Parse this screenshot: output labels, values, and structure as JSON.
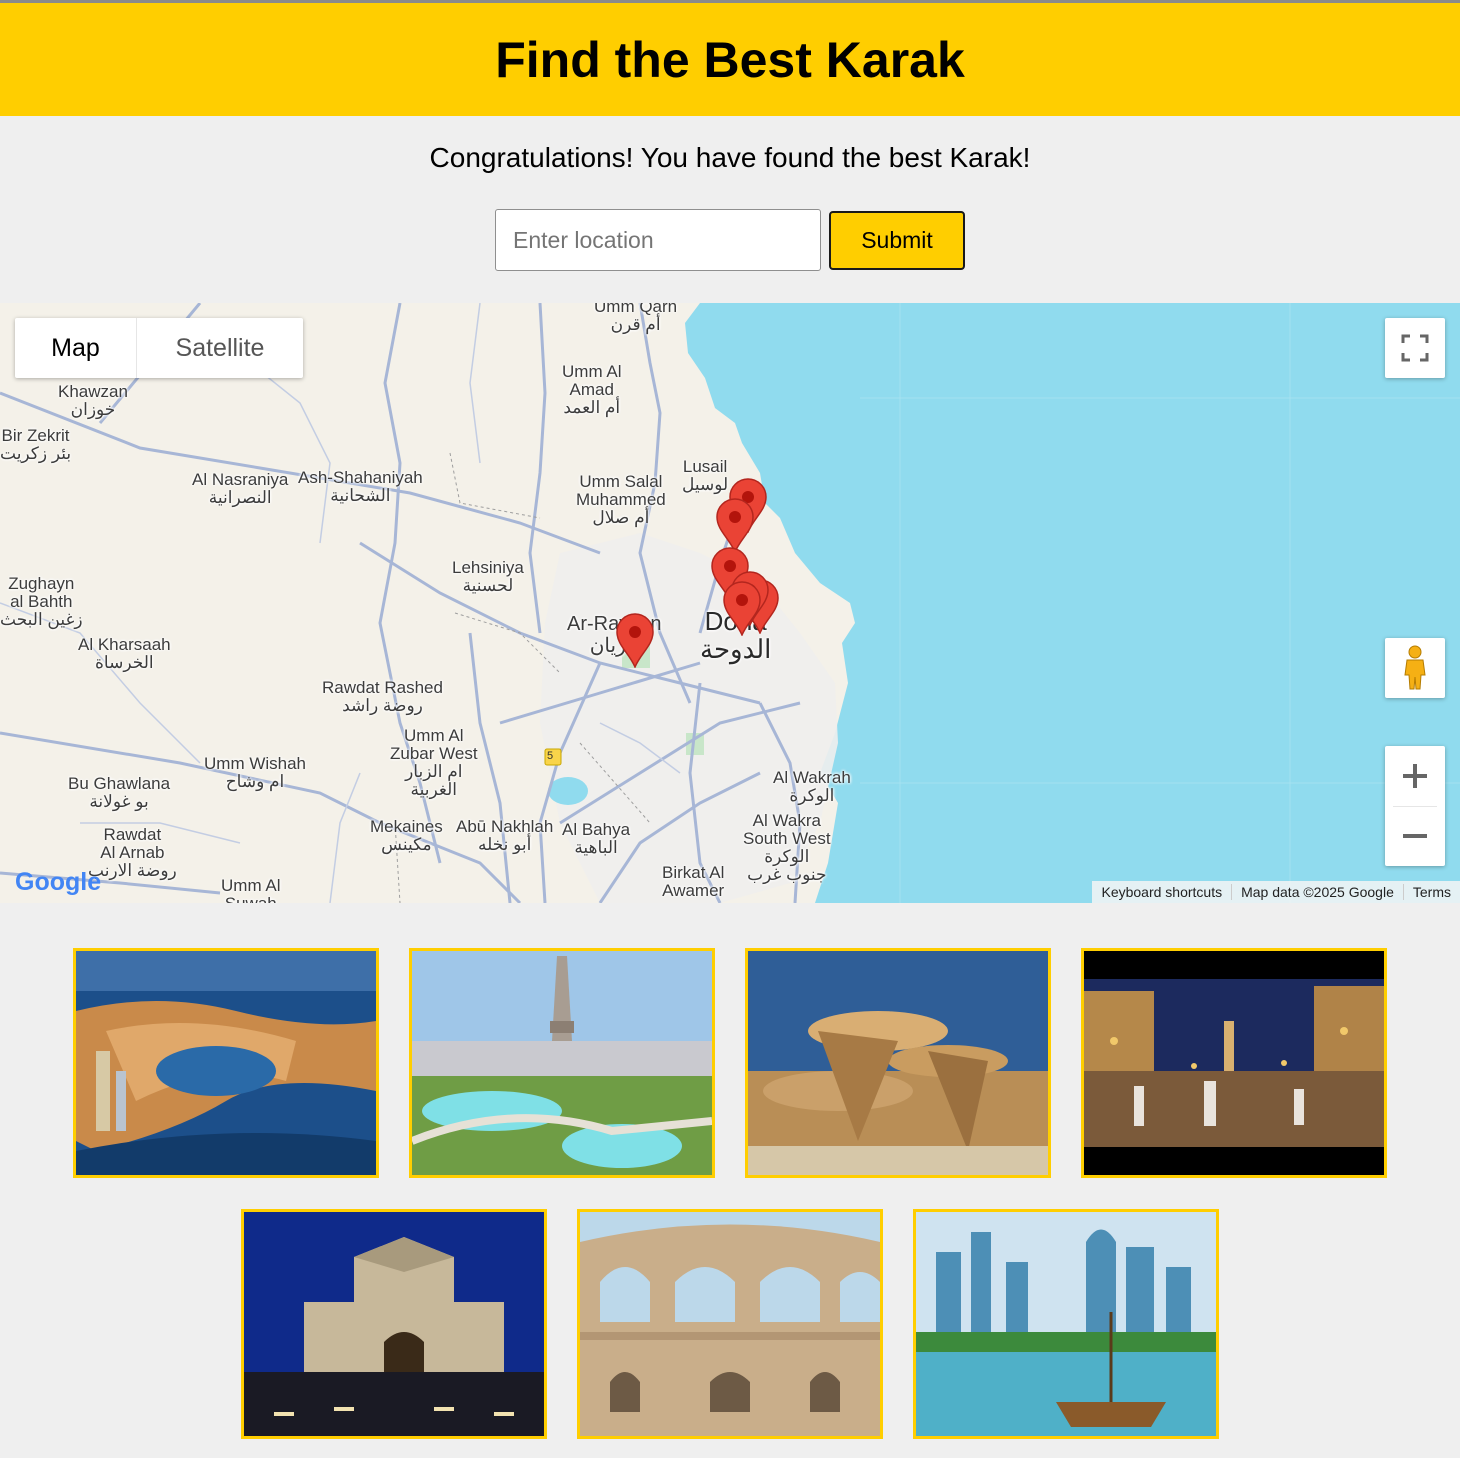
{
  "header": {
    "title": "Find the Best Karak"
  },
  "message": "Congratulations! You have found the best Karak!",
  "form": {
    "placeholder": "Enter location",
    "value": "",
    "submit_label": "Submit"
  },
  "map": {
    "type_map": "Map",
    "type_satellite": "Satellite",
    "labels": {
      "umm_qarn": "Umm Qarn",
      "umm_qarn_ar": "أم قرن",
      "umm_al_amad_1": "Umm Al",
      "umm_al_amad_2": "Amad",
      "umm_al_amad_ar": "أم العمد",
      "khawzan": "Khawzan",
      "khawzan_ar": "خوزان",
      "bir_zekrit": "Bir Zekrit",
      "bir_zekrit_ar": "بئر زكريت",
      "al_nasraniya": "Al Nasraniya",
      "al_nasraniya_ar": "النصرانية",
      "ash_shahaniyah": "Ash-Shahaniyah",
      "ash_shahaniyah_ar": "الشحانية",
      "lusail": "Lusail",
      "lusail_ar": "لوسيل",
      "umm_salal_1": "Umm Salal",
      "umm_salal_2": "Muhammed",
      "umm_salal_ar": "أم صلال",
      "lehsiniya": "Lehsiniya",
      "lehsiniya_ar": "لحسنية",
      "zughayn_1": "Zughayn",
      "zughayn_2": "al Bahth",
      "zughayn_ar": "زغين البحث",
      "al_kharsaah": "Al Kharsaah",
      "al_kharsaah_ar": "الخرساة",
      "ar_rayyan": "Ar-Rayyan",
      "ar_rayyan_ar": "الريان",
      "doha": "Doha",
      "doha_ar": "الدوحة",
      "rawdat_rashed": "Rawdat Rashed",
      "rawdat_rashed_ar": "روضة راشد",
      "umm_al_zubar_1": "Umm Al",
      "umm_al_zubar_2": "Zubar West",
      "umm_al_zubar_ar1": "ام الزبار",
      "umm_al_zubar_ar2": "الغربية",
      "umm_wishah": "Umm Wishah",
      "umm_wishah_ar": "ام وشاح",
      "bu_ghawlana": "Bu Ghawlana",
      "bu_ghawlana_ar": "بو غولانة",
      "rawdat_al_arnab_1": "Rawdat",
      "rawdat_al_arnab_2": "Al Arnab",
      "rawdat_al_arnab_ar": "روضة الارنب",
      "mekaines": "Mekaines",
      "mekaines_ar": "مكينس",
      "abu_nakhlah": "Abū Nakhlah",
      "abu_nakhlah_ar": "أبو نخله",
      "al_bahya": "Al Bahya",
      "al_bahya_ar": "الباهية",
      "al_wakrah": "Al Wakrah",
      "al_wakrah_ar": "الوكرة",
      "al_wakra_sw_1": "Al Wakra",
      "al_wakra_sw_2": "South West",
      "al_wakra_sw_ar1": "الوكرة",
      "al_wakra_sw_ar2": "جنوب غرب",
      "birkat_1": "Birkat Al",
      "birkat_2": "Awamer",
      "umm_al_suwah_1": "Umm Al",
      "umm_al_suwah_2": "Suwah",
      "route": "5"
    },
    "attribution": {
      "shortcuts": "Keyboard shortcuts",
      "data": "Map data ©2025 Google",
      "terms": "Terms"
    },
    "logo": "Google",
    "colors": {
      "water": "#90dbee",
      "land": "#f4f1e9",
      "pin": "#ea4335",
      "road": "#a7b6d6"
    }
  },
  "gallery": {
    "images": [
      {
        "name": "the-pearl"
      },
      {
        "name": "aspire-park"
      },
      {
        "name": "national-museum"
      },
      {
        "name": "souq-waqif"
      },
      {
        "name": "museum-of-islamic-art"
      },
      {
        "name": "katara-amphitheatre"
      },
      {
        "name": "doha-skyline-dhow"
      }
    ]
  },
  "theme": {
    "accent": "#ffce00",
    "background": "#efefef"
  }
}
